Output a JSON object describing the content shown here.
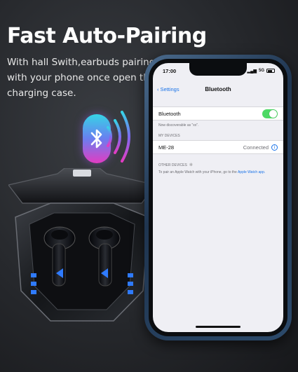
{
  "headline": "Fast Auto-Pairing",
  "subtext": "With hall Swith,earbuds pairing with your phone once open the charging case.",
  "icons": {
    "bluetooth": "bluetooth-icon",
    "signal_waves": "signal-waves-icon"
  },
  "colors": {
    "toggle_on": "#4cd964",
    "link_blue": "#1a73e8",
    "case_led": "#2f7bff"
  },
  "phone": {
    "status": {
      "time": "17:00",
      "network": "5G"
    },
    "nav": {
      "back_label": "Settings",
      "title": "Bluetooth"
    },
    "bluetooth_row": {
      "label": "Bluetooth",
      "enabled": true
    },
    "discoverable_note": "Now discoverable as \"xx\".",
    "my_devices_header": "MY DEVICES",
    "device": {
      "name": "ME-28",
      "status": "Connected"
    },
    "other_devices_header": "OTHER DEVICES",
    "apple_watch_note": "To pair an Apple Watch with your iPhone, go to the",
    "apple_watch_link": "Apple Watch app."
  }
}
